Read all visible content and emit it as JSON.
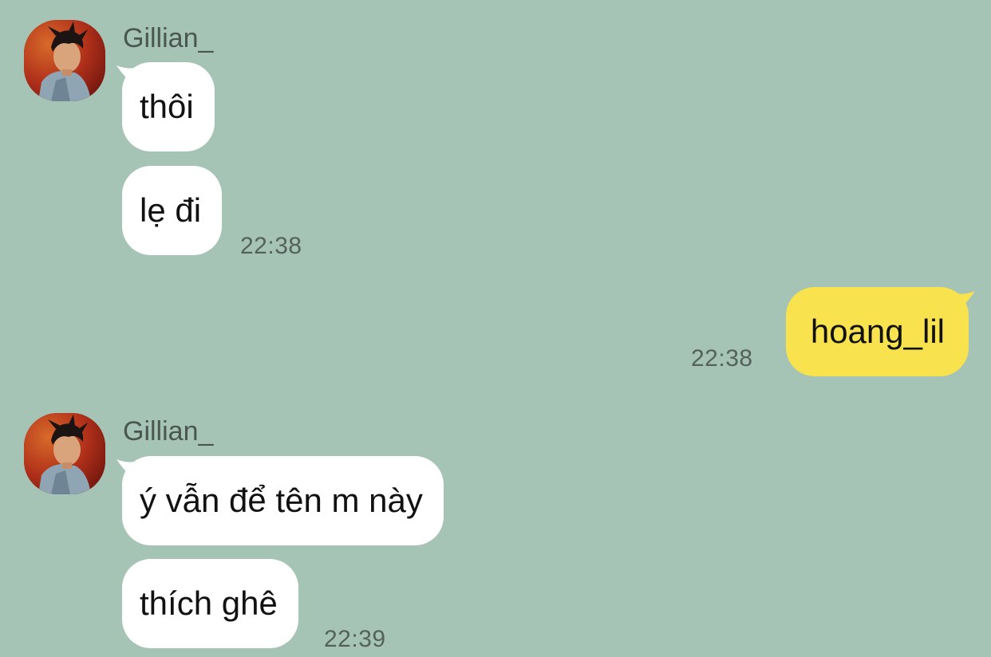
{
  "contacts": {
    "other": {
      "name": "Gillian_"
    }
  },
  "messages": [
    {
      "id": "m1",
      "text": "thôi"
    },
    {
      "id": "m2",
      "text": "lẹ đi",
      "time": "22:38"
    },
    {
      "id": "m3",
      "text": "hoang_lil",
      "time": "22:38"
    },
    {
      "id": "m4",
      "text": "ý vẫn để tên m này"
    },
    {
      "id": "m5",
      "text": "thích ghê",
      "time": "22:39"
    }
  ],
  "colors": {
    "background": "#a6c4b6",
    "incoming_bubble": "#ffffff",
    "outgoing_bubble": "#f8e24d"
  }
}
